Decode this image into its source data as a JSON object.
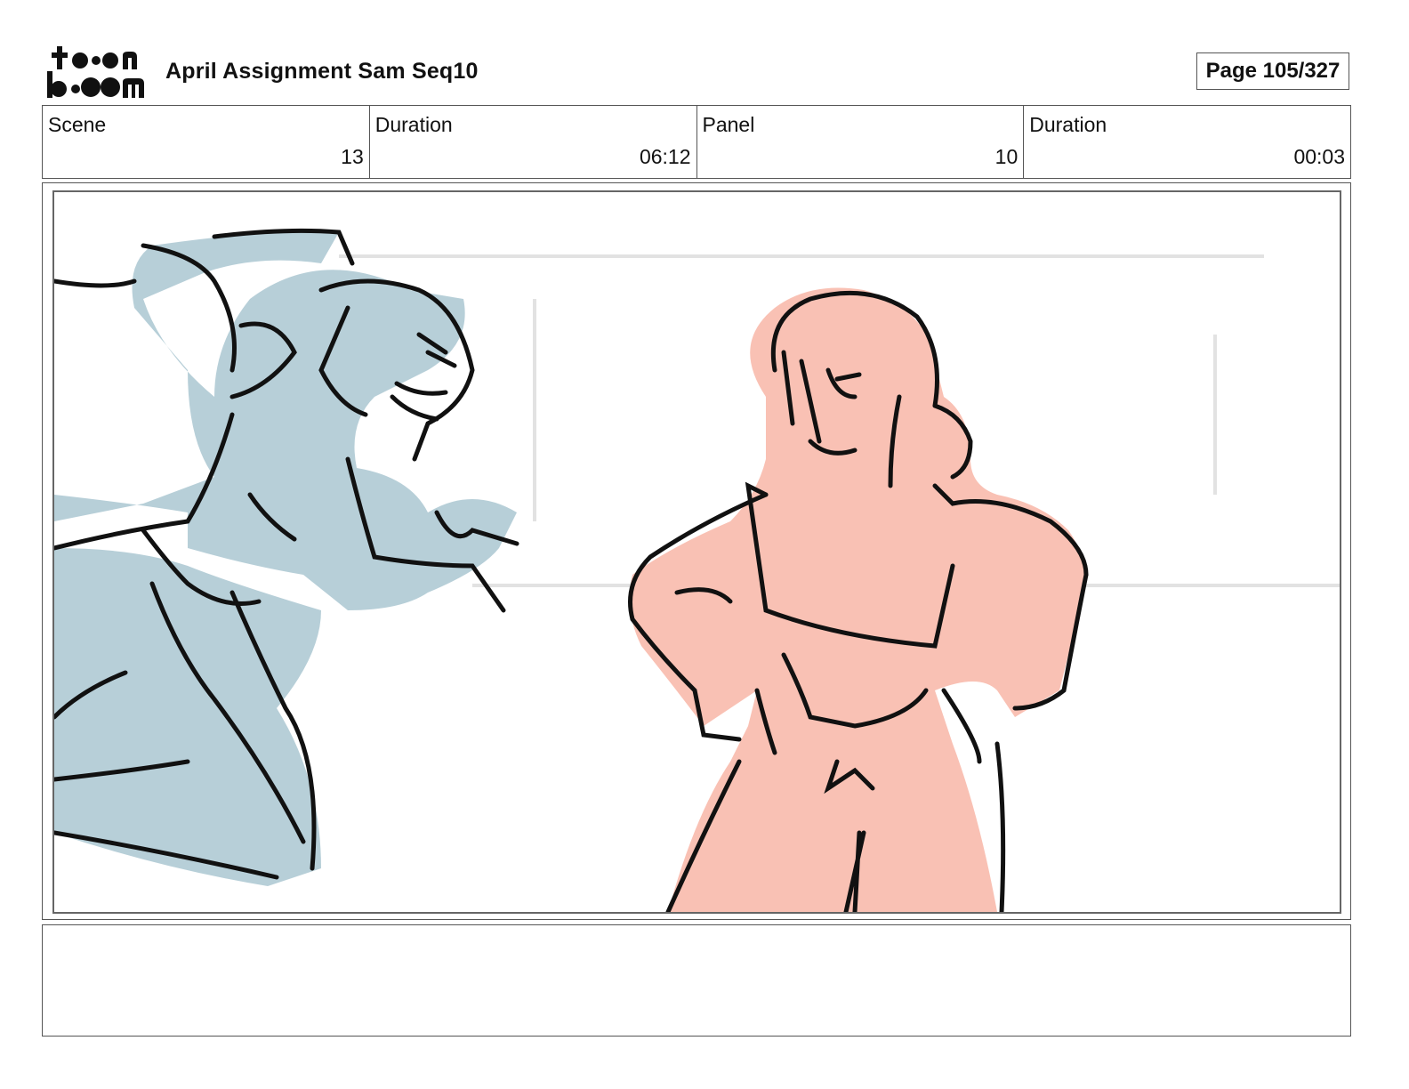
{
  "header": {
    "logo_text": "toon boom",
    "title": "April Assignment Sam Seq10",
    "page_label": "Page 105/327"
  },
  "info": [
    {
      "label": "Scene",
      "value": "13"
    },
    {
      "label": "Duration",
      "value": "06:12"
    },
    {
      "label": "Panel",
      "value": "10"
    },
    {
      "label": "Duration",
      "value": "00:03"
    }
  ],
  "panel": {
    "description_icons": [
      "goblin-character-sketch",
      "girl-character-sketch"
    ],
    "colors": {
      "goblin_fill": "#b7cfd8",
      "girl_fill": "#f9c1b4",
      "line": "#111111",
      "guide": "#e2e2e2"
    }
  },
  "caption": {
    "text": ""
  }
}
